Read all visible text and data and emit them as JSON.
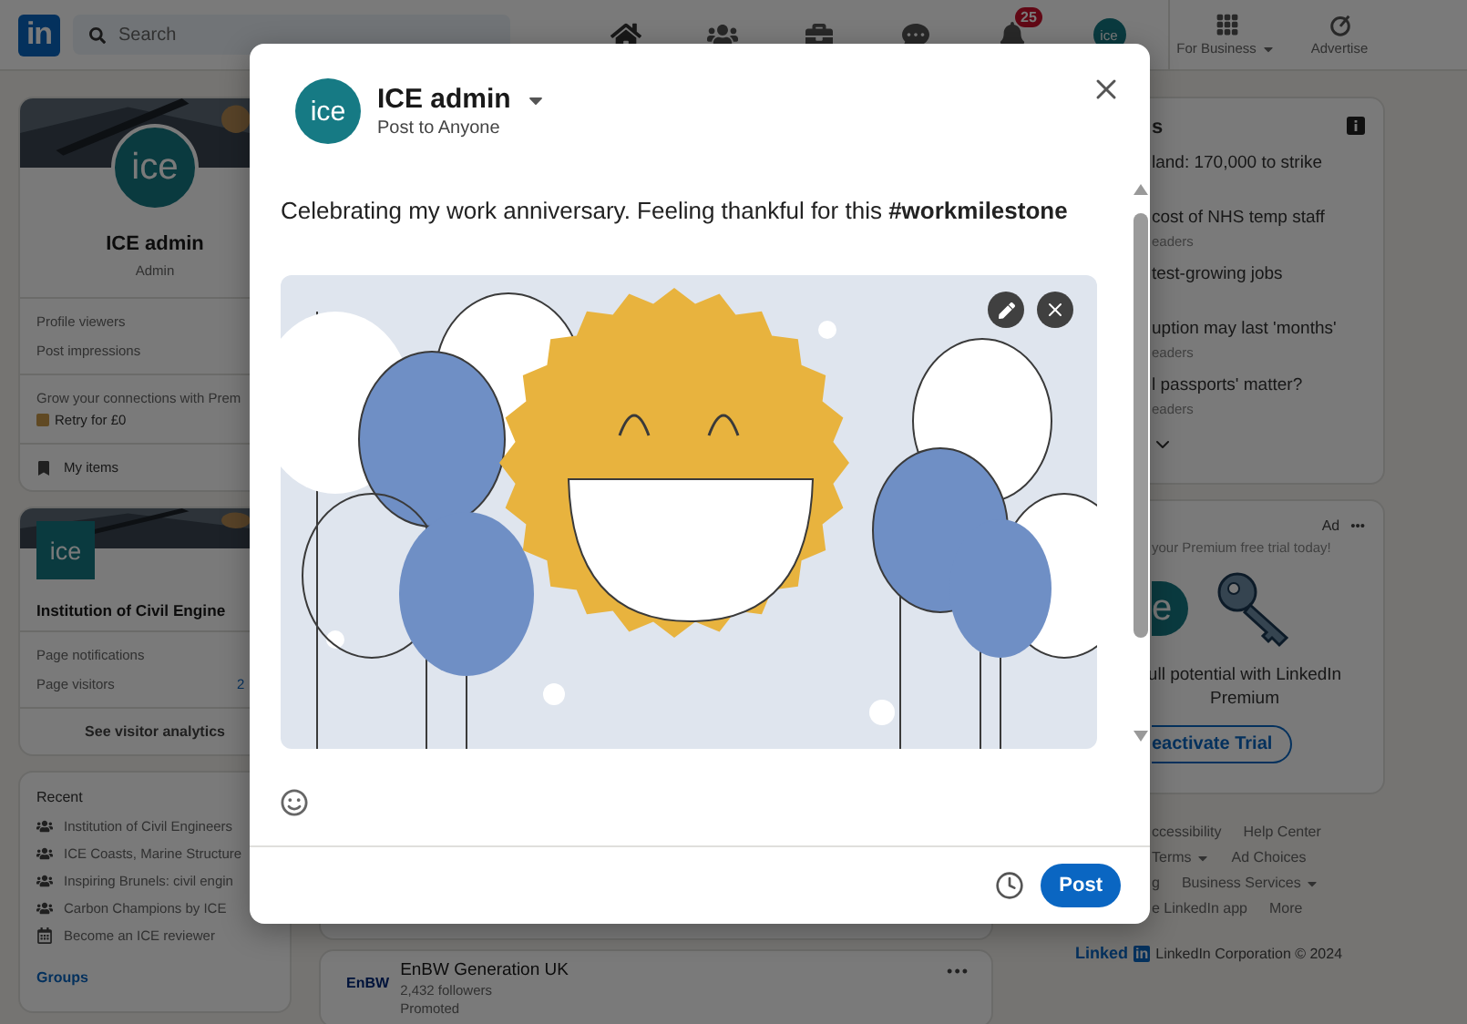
{
  "nav": {
    "logo": "in",
    "search": {
      "placeholder": "Search"
    },
    "items": [
      {
        "kind": "home"
      },
      {
        "kind": "network"
      },
      {
        "kind": "jobs"
      },
      {
        "kind": "messaging"
      },
      {
        "kind": "notifications",
        "badge": "25"
      },
      {
        "kind": "avatar",
        "text": "ice"
      }
    ],
    "business": [
      {
        "kind": "apps",
        "label": "For Business",
        "dropdown": true
      },
      {
        "kind": "advertise",
        "label": "Advertise",
        "dropdown": false
      }
    ]
  },
  "profile_card": {
    "avatar": "ice",
    "name": "ICE admin",
    "role": "Admin",
    "stats": [
      "Profile viewers",
      "Post impressions"
    ],
    "premium_prompt": "Grow your connections with Prem",
    "premium_link": "Retry for £0",
    "my_items": "My items"
  },
  "page_card": {
    "logo": "ice",
    "name": "Institution of Civil Engine",
    "stats": [
      {
        "label": "Page notifications"
      },
      {
        "label": "Page visitors",
        "value": "2"
      }
    ],
    "analytics": "See visitor analytics"
  },
  "recent": {
    "title": "Recent",
    "items": [
      {
        "kind": "group",
        "label": "Institution of Civil Engineers"
      },
      {
        "kind": "group",
        "label": "ICE Coasts, Marine Structure"
      },
      {
        "kind": "group",
        "label": "Inspiring Brunels: civil engin"
      },
      {
        "kind": "group",
        "label": "Carbon Champions by ICE"
      },
      {
        "kind": "event",
        "label": "Become an ICE reviewer"
      }
    ],
    "groups": "Groups"
  },
  "feed": {
    "cards": [
      {
        "logo": "EnBW",
        "name": "EnBW Generation UK",
        "followers": "2,432 followers",
        "tag": "Promoted",
        "more": "•••"
      }
    ]
  },
  "news": {
    "title": "s",
    "items": [
      {
        "headline": "land: 170,000 to strike"
      },
      {
        "headline": "cost of NHS temp staff",
        "meta": "eaders"
      },
      {
        "headline": "test-growing jobs"
      },
      {
        "headline": "uption may last 'months'",
        "meta": "eaders"
      },
      {
        "headline": "l passports' matter?",
        "meta": "eaders"
      }
    ]
  },
  "ad": {
    "label": "Ad",
    "more": "•••",
    "text": "your Premium free trial today!",
    "logo": "e",
    "body": "ull potential with LinkedIn Premium",
    "button": "eactivate Trial"
  },
  "footer": {
    "rows": [
      [
        {
          "label": "ccessibility",
          "dropdown": false
        },
        {
          "label": "Help Center",
          "dropdown": false
        }
      ],
      [
        {
          "label": "Terms",
          "dropdown": true
        },
        {
          "label": "Ad Choices",
          "dropdown": false
        }
      ],
      [
        {
          "label": "g",
          "dropdown": false
        },
        {
          "label": "Business Services",
          "dropdown": true
        }
      ],
      [
        {
          "label": "e LinkedIn app",
          "dropdown": false
        },
        {
          "label": "More",
          "dropdown": false
        }
      ]
    ],
    "brand_word": "Linked",
    "brand_box": "in",
    "copyright": "LinkedIn Corporation © 2024"
  },
  "composer": {
    "avatar": "ice",
    "author": "ICE admin",
    "audience": "Post to Anyone",
    "text": "Celebrating my work anniversary. Feeling thankful for this **#workmilestone**",
    "post_button": "Post"
  }
}
